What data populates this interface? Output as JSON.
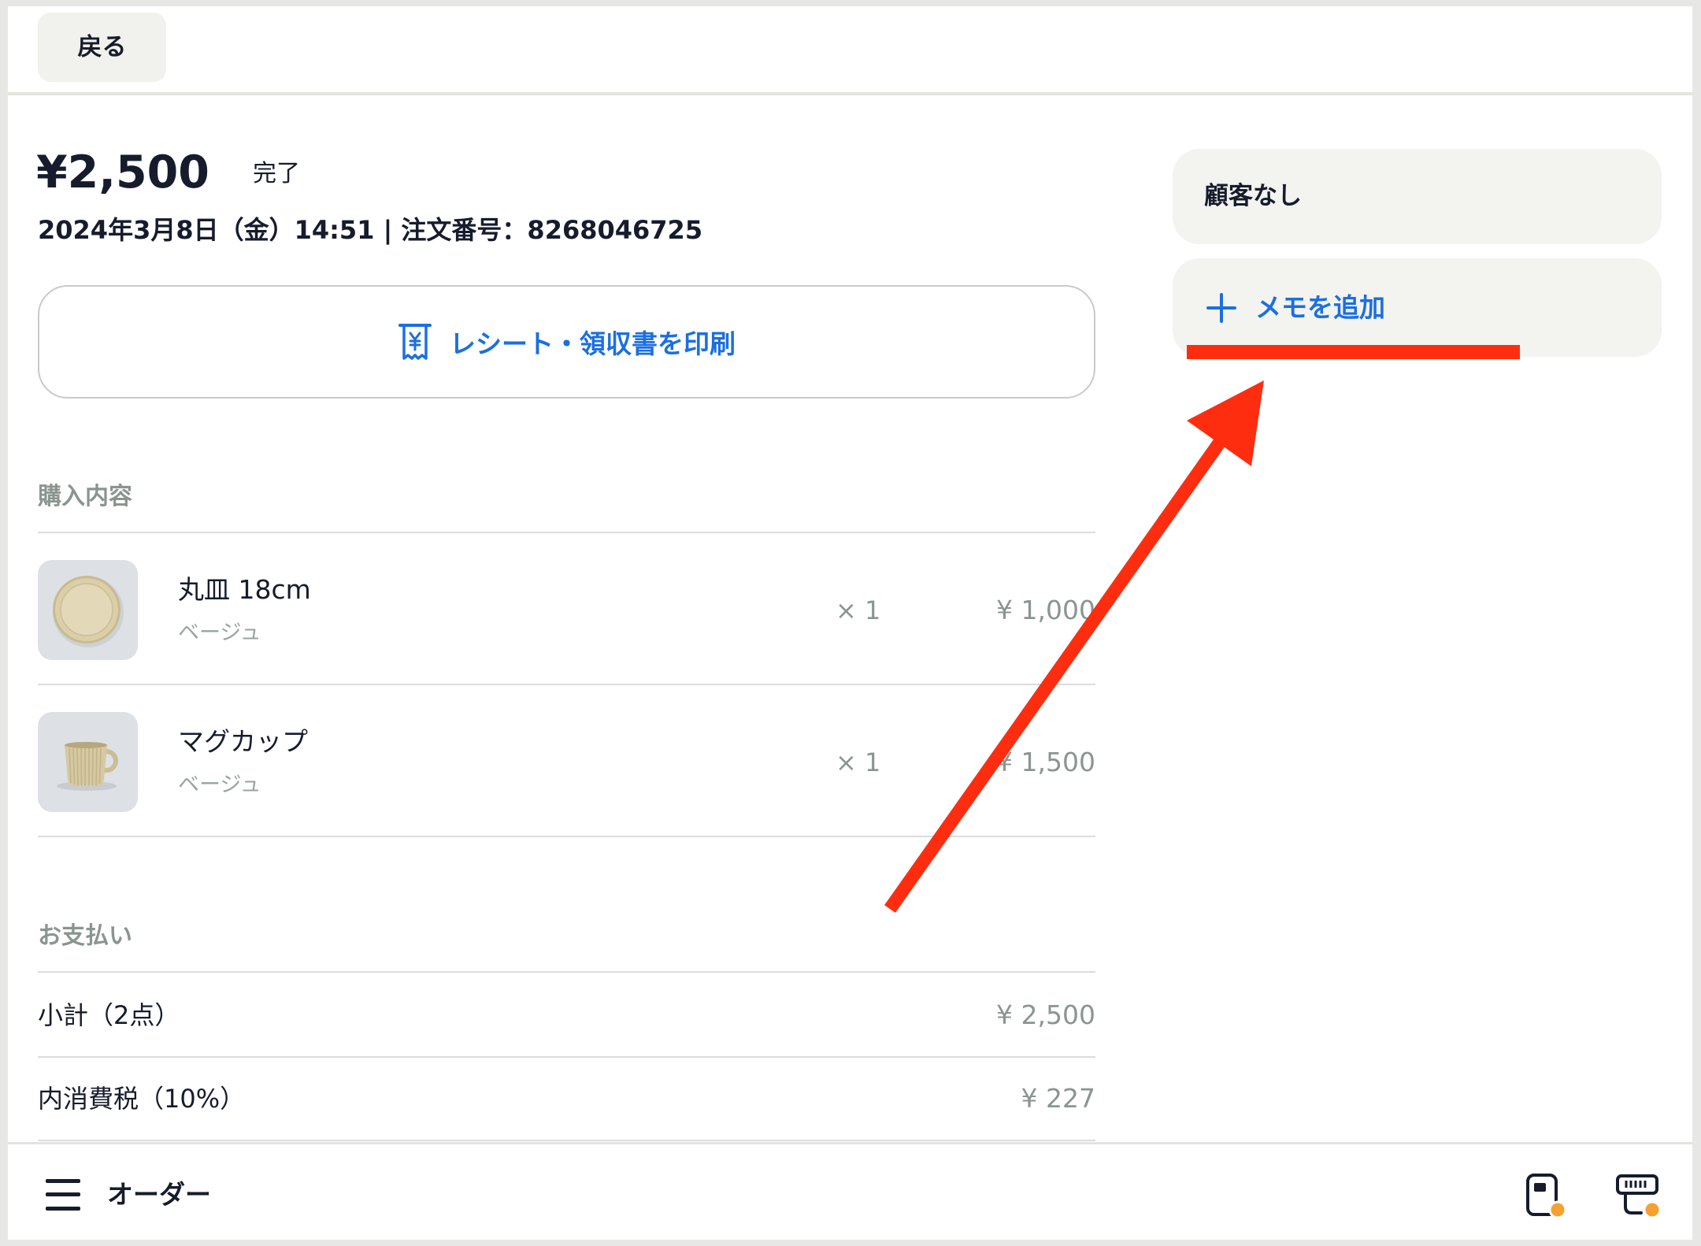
{
  "header": {
    "back_label": "戻る"
  },
  "order": {
    "total": "¥2,500",
    "status": "完了",
    "meta": "2024年3月8日（金）14:51 | 注文番号：8268046725"
  },
  "print_button": {
    "label": "レシート・領収書を印刷",
    "icon": "receipt-yen-icon"
  },
  "purchase": {
    "heading": "購入内容",
    "items": [
      {
        "name": "丸皿 18cm",
        "variant": "ベージュ",
        "quantity": "× 1",
        "price": "¥ 1,000",
        "thumbnail": "plate-thumbnail"
      },
      {
        "name": "マグカップ",
        "variant": "ベージュ",
        "quantity": "× 1",
        "price": "¥ 1,500",
        "thumbnail": "mug-thumbnail"
      }
    ]
  },
  "payment": {
    "heading": "お支払い",
    "rows": [
      {
        "label": "小計（2点）",
        "value": "¥ 2,500"
      },
      {
        "label": "内消費税（10%）",
        "value": "¥ 227"
      }
    ]
  },
  "side_panel": {
    "customer_label": "顧客なし",
    "memo_label": "メモを追加",
    "memo_icon": "plus-icon"
  },
  "bottom_nav": {
    "menu_icon": "hamburger-menu-icon",
    "title": "オーダー",
    "right_icons": [
      "card-reader-icon",
      "receipt-printer-icon"
    ]
  },
  "colors": {
    "accent_blue": "#1b6fe0",
    "annotation_red": "#ff2d0f",
    "status_dot_orange": "#f5a130",
    "muted_text": "#8b9590"
  }
}
